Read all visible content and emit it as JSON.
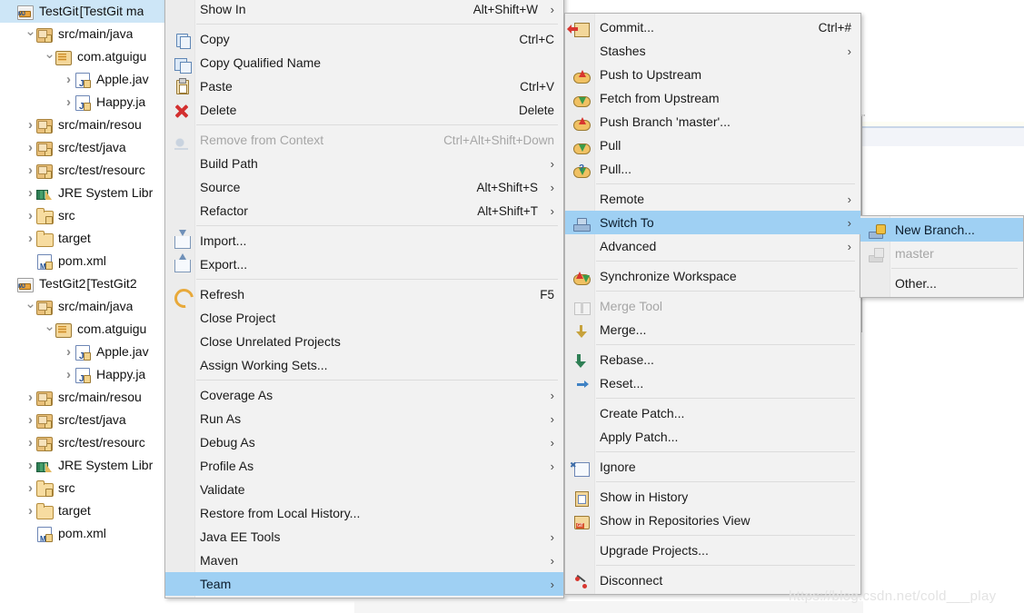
{
  "app": "Eclipse IDE - Package Explorer with Team context menu",
  "tree": {
    "name": "package-explorer",
    "items": [
      {
        "label": "TestGit ",
        "dim": "[TestGit ma",
        "icon": "project-icon",
        "indent": 0,
        "twist": "none",
        "selected": true
      },
      {
        "label": "src/main/java",
        "dim": "",
        "icon": "source-folder-icon",
        "indent": 1,
        "twist": "open",
        "selected": false
      },
      {
        "label": "com.atguigu",
        "dim": "",
        "icon": "package-icon",
        "indent": 2,
        "twist": "open",
        "selected": false
      },
      {
        "label": "Apple.jav",
        "dim": "",
        "icon": "java-file-icon",
        "indent": 3,
        "twist": "closed",
        "selected": false
      },
      {
        "label": "Happy.ja",
        "dim": "",
        "icon": "java-file-icon",
        "indent": 3,
        "twist": "closed",
        "selected": false
      },
      {
        "label": "src/main/resou",
        "dim": "",
        "icon": "source-folder-icon",
        "indent": 1,
        "twist": "closed",
        "selected": false
      },
      {
        "label": "src/test/java",
        "dim": "",
        "icon": "source-folder-icon",
        "indent": 1,
        "twist": "closed",
        "selected": false
      },
      {
        "label": "src/test/resourc",
        "dim": "",
        "icon": "source-folder-icon",
        "indent": 1,
        "twist": "closed",
        "selected": false
      },
      {
        "label": "JRE System Libr",
        "dim": "",
        "icon": "jre-library-icon",
        "indent": 1,
        "twist": "closed",
        "selected": false
      },
      {
        "label": "src",
        "dim": "",
        "icon": "folder-icon",
        "indent": 1,
        "twist": "closed",
        "selected": false
      },
      {
        "label": "target",
        "dim": "",
        "icon": "plain-folder-icon",
        "indent": 1,
        "twist": "closed",
        "selected": false
      },
      {
        "label": "pom.xml",
        "dim": "",
        "icon": "maven-pom-icon",
        "indent": 1,
        "twist": "none",
        "selected": false
      },
      {
        "label": "TestGit2 ",
        "dim": "[TestGit2 ",
        "icon": "project-icon",
        "indent": 0,
        "twist": "none",
        "selected": false
      },
      {
        "label": "src/main/java",
        "dim": "",
        "icon": "source-folder-icon",
        "indent": 1,
        "twist": "open",
        "selected": false
      },
      {
        "label": "com.atguigu",
        "dim": "",
        "icon": "package-icon",
        "indent": 2,
        "twist": "open",
        "selected": false
      },
      {
        "label": "Apple.jav",
        "dim": "",
        "icon": "java-file-icon",
        "indent": 3,
        "twist": "closed",
        "selected": false
      },
      {
        "label": "Happy.ja",
        "dim": "",
        "icon": "java-file-icon",
        "indent": 3,
        "twist": "closed",
        "selected": false
      },
      {
        "label": "src/main/resou",
        "dim": "",
        "icon": "source-folder-icon",
        "indent": 1,
        "twist": "closed",
        "selected": false
      },
      {
        "label": "src/test/java",
        "dim": "",
        "icon": "source-folder-icon",
        "indent": 1,
        "twist": "closed",
        "selected": false
      },
      {
        "label": "src/test/resourc",
        "dim": "",
        "icon": "source-folder-icon",
        "indent": 1,
        "twist": "closed",
        "selected": false
      },
      {
        "label": "JRE System Libr",
        "dim": "",
        "icon": "jre-library-icon",
        "indent": 1,
        "twist": "closed",
        "selected": false
      },
      {
        "label": "src",
        "dim": "",
        "icon": "folder-icon",
        "indent": 1,
        "twist": "closed",
        "selected": false
      },
      {
        "label": "target",
        "dim": "",
        "icon": "plain-folder-icon",
        "indent": 1,
        "twist": "closed",
        "selected": false
      },
      {
        "label": "pom.xml",
        "dim": "",
        "icon": "maven-pom-icon",
        "indent": 1,
        "twist": "none",
        "selected": false
      }
    ]
  },
  "context_menu": {
    "name": "project-context-menu",
    "items": [
      {
        "type": "item",
        "label": "Show In",
        "accel": "Alt+Shift+W",
        "submenu": true,
        "icon": "",
        "disabled": false,
        "highlighted": false
      },
      {
        "type": "sep"
      },
      {
        "type": "item",
        "label": "Copy",
        "accel": "Ctrl+C",
        "submenu": false,
        "icon": "copy-icon",
        "disabled": false,
        "highlighted": false
      },
      {
        "type": "item",
        "label": "Copy Qualified Name",
        "accel": "",
        "submenu": false,
        "icon": "copy-qualified-name-icon",
        "disabled": false,
        "highlighted": false
      },
      {
        "type": "item",
        "label": "Paste",
        "accel": "Ctrl+V",
        "submenu": false,
        "icon": "paste-icon",
        "disabled": false,
        "highlighted": false
      },
      {
        "type": "item",
        "label": "Delete",
        "accel": "Delete",
        "submenu": false,
        "icon": "delete-icon",
        "disabled": false,
        "highlighted": false
      },
      {
        "type": "sep"
      },
      {
        "type": "item",
        "label": "Remove from Context",
        "accel": "Ctrl+Alt+Shift+Down",
        "submenu": false,
        "icon": "remove-from-context-icon",
        "disabled": true,
        "highlighted": false
      },
      {
        "type": "item",
        "label": "Build Path",
        "accel": "",
        "submenu": true,
        "icon": "",
        "disabled": false,
        "highlighted": false
      },
      {
        "type": "item",
        "label": "Source",
        "accel": "Alt+Shift+S",
        "submenu": true,
        "icon": "",
        "disabled": false,
        "highlighted": false
      },
      {
        "type": "item",
        "label": "Refactor",
        "accel": "Alt+Shift+T",
        "submenu": true,
        "icon": "",
        "disabled": false,
        "highlighted": false
      },
      {
        "type": "sep"
      },
      {
        "type": "item",
        "label": "Import...",
        "accel": "",
        "submenu": false,
        "icon": "import-icon",
        "disabled": false,
        "highlighted": false
      },
      {
        "type": "item",
        "label": "Export...",
        "accel": "",
        "submenu": false,
        "icon": "export-icon",
        "disabled": false,
        "highlighted": false
      },
      {
        "type": "sep"
      },
      {
        "type": "item",
        "label": "Refresh",
        "accel": "F5",
        "submenu": false,
        "icon": "refresh-icon",
        "disabled": false,
        "highlighted": false
      },
      {
        "type": "item",
        "label": "Close Project",
        "accel": "",
        "submenu": false,
        "icon": "",
        "disabled": false,
        "highlighted": false
      },
      {
        "type": "item",
        "label": "Close Unrelated Projects",
        "accel": "",
        "submenu": false,
        "icon": "",
        "disabled": false,
        "highlighted": false
      },
      {
        "type": "item",
        "label": "Assign Working Sets...",
        "accel": "",
        "submenu": false,
        "icon": "",
        "disabled": false,
        "highlighted": false
      },
      {
        "type": "sep"
      },
      {
        "type": "item",
        "label": "Coverage As",
        "accel": "",
        "submenu": true,
        "icon": "",
        "disabled": false,
        "highlighted": false
      },
      {
        "type": "item",
        "label": "Run As",
        "accel": "",
        "submenu": true,
        "icon": "",
        "disabled": false,
        "highlighted": false
      },
      {
        "type": "item",
        "label": "Debug As",
        "accel": "",
        "submenu": true,
        "icon": "",
        "disabled": false,
        "highlighted": false
      },
      {
        "type": "item",
        "label": "Profile As",
        "accel": "",
        "submenu": true,
        "icon": "",
        "disabled": false,
        "highlighted": false
      },
      {
        "type": "item",
        "label": "Validate",
        "accel": "",
        "submenu": false,
        "icon": "",
        "disabled": false,
        "highlighted": false
      },
      {
        "type": "item",
        "label": "Restore from Local History...",
        "accel": "",
        "submenu": false,
        "icon": "",
        "disabled": false,
        "highlighted": false
      },
      {
        "type": "item",
        "label": "Java EE Tools",
        "accel": "",
        "submenu": true,
        "icon": "",
        "disabled": false,
        "highlighted": false
      },
      {
        "type": "item",
        "label": "Maven",
        "accel": "",
        "submenu": true,
        "icon": "",
        "disabled": false,
        "highlighted": false
      },
      {
        "type": "item",
        "label": "Team",
        "accel": "",
        "submenu": true,
        "icon": "",
        "disabled": false,
        "highlighted": true
      }
    ]
  },
  "team_menu": {
    "name": "team-submenu",
    "items": [
      {
        "type": "item",
        "label": "Commit...",
        "accel": "Ctrl+#",
        "submenu": false,
        "icon": "commit-icon",
        "disabled": false,
        "highlighted": false
      },
      {
        "type": "item",
        "label": "Stashes",
        "accel": "",
        "submenu": true,
        "icon": "",
        "disabled": false,
        "highlighted": false
      },
      {
        "type": "item",
        "label": "Push to Upstream",
        "accel": "",
        "submenu": false,
        "icon": "push-icon",
        "disabled": false,
        "highlighted": false
      },
      {
        "type": "item",
        "label": "Fetch from Upstream",
        "accel": "",
        "submenu": false,
        "icon": "fetch-icon",
        "disabled": false,
        "highlighted": false
      },
      {
        "type": "item",
        "label": "Push Branch 'master'...",
        "accel": "",
        "submenu": false,
        "icon": "push-branch-icon",
        "disabled": false,
        "highlighted": false
      },
      {
        "type": "item",
        "label": "Pull",
        "accel": "",
        "submenu": false,
        "icon": "pull-icon",
        "disabled": false,
        "highlighted": false
      },
      {
        "type": "item",
        "label": "Pull...",
        "accel": "",
        "submenu": false,
        "icon": "pull-options-icon",
        "disabled": false,
        "highlighted": false
      },
      {
        "type": "sep"
      },
      {
        "type": "item",
        "label": "Remote",
        "accel": "",
        "submenu": true,
        "icon": "",
        "disabled": false,
        "highlighted": false
      },
      {
        "type": "item",
        "label": "Switch To",
        "accel": "",
        "submenu": true,
        "icon": "switch-to-icon",
        "disabled": false,
        "highlighted": true
      },
      {
        "type": "item",
        "label": "Advanced",
        "accel": "",
        "submenu": true,
        "icon": "",
        "disabled": false,
        "highlighted": false
      },
      {
        "type": "sep"
      },
      {
        "type": "item",
        "label": "Synchronize Workspace",
        "accel": "",
        "submenu": false,
        "icon": "synchronize-icon",
        "disabled": false,
        "highlighted": false
      },
      {
        "type": "sep"
      },
      {
        "type": "item",
        "label": "Merge Tool",
        "accel": "",
        "submenu": false,
        "icon": "merge-tool-icon",
        "disabled": true,
        "highlighted": false
      },
      {
        "type": "item",
        "label": "Merge...",
        "accel": "",
        "submenu": false,
        "icon": "merge-icon",
        "disabled": false,
        "highlighted": false
      },
      {
        "type": "sep"
      },
      {
        "type": "item",
        "label": "Rebase...",
        "accel": "",
        "submenu": false,
        "icon": "rebase-icon",
        "disabled": false,
        "highlighted": false
      },
      {
        "type": "item",
        "label": "Reset...",
        "accel": "",
        "submenu": false,
        "icon": "reset-icon",
        "disabled": false,
        "highlighted": false
      },
      {
        "type": "sep"
      },
      {
        "type": "item",
        "label": "Create Patch...",
        "accel": "",
        "submenu": false,
        "icon": "",
        "disabled": false,
        "highlighted": false
      },
      {
        "type": "item",
        "label": "Apply Patch...",
        "accel": "",
        "submenu": false,
        "icon": "",
        "disabled": false,
        "highlighted": false
      },
      {
        "type": "sep"
      },
      {
        "type": "item",
        "label": "Ignore",
        "accel": "",
        "submenu": false,
        "icon": "ignore-icon",
        "disabled": false,
        "highlighted": false
      },
      {
        "type": "sep"
      },
      {
        "type": "item",
        "label": "Show in History",
        "accel": "",
        "submenu": false,
        "icon": "show-in-history-icon",
        "disabled": false,
        "highlighted": false
      },
      {
        "type": "item",
        "label": "Show in Repositories View",
        "accel": "",
        "submenu": false,
        "icon": "show-in-repositories-icon",
        "disabled": false,
        "highlighted": false
      },
      {
        "type": "sep"
      },
      {
        "type": "item",
        "label": "Upgrade Projects...",
        "accel": "",
        "submenu": false,
        "icon": "",
        "disabled": false,
        "highlighted": false
      },
      {
        "type": "sep"
      },
      {
        "type": "item",
        "label": "Disconnect",
        "accel": "",
        "submenu": false,
        "icon": "disconnect-icon",
        "disabled": false,
        "highlighted": false
      }
    ]
  },
  "switch_to_menu": {
    "name": "switch-to-submenu",
    "items": [
      {
        "type": "item",
        "label": "New Branch...",
        "accel": "",
        "submenu": false,
        "icon": "new-branch-icon",
        "disabled": false,
        "highlighted": true
      },
      {
        "type": "item",
        "label": "master",
        "accel": "",
        "submenu": false,
        "icon": "master-branch-icon",
        "disabled": true,
        "highlighted": false
      },
      {
        "type": "sep"
      },
      {
        "type": "item",
        "label": "Other...",
        "accel": "",
        "submenu": false,
        "icon": "",
        "disabled": false,
        "highlighted": false
      }
    ]
  },
  "watermark": "https://blog.csdn.net/cold___play",
  "colors": {
    "menu_background": "#f2f2f2",
    "menu_gutter": "#ececec",
    "highlight": "#9fd0f3",
    "tree_selection": "#cde6f7",
    "disabled_text": "#a6a6a6",
    "separator": "#dcdcdc"
  }
}
